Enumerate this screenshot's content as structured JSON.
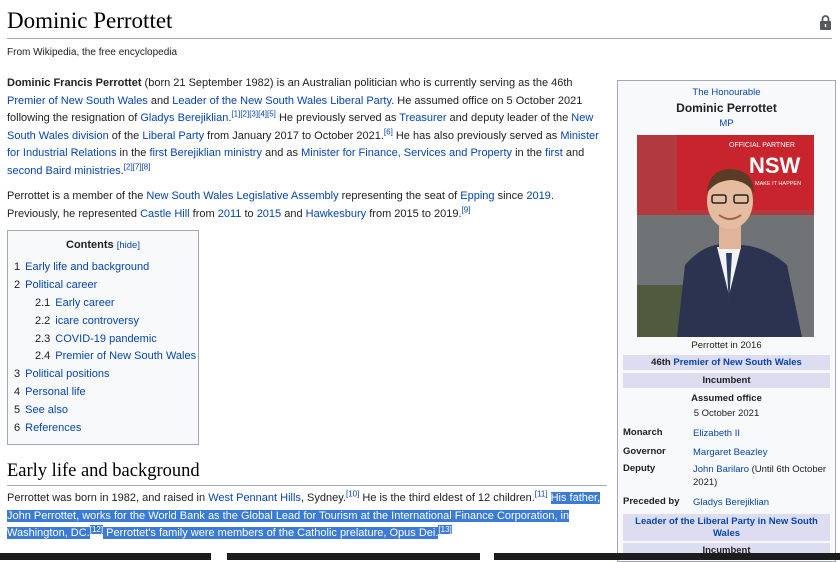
{
  "page": {
    "title": "Dominic Perrottet",
    "tagline": "From Wikipedia, the free encyclopedia",
    "lock_icon": "lock-icon"
  },
  "lead": {
    "p1": {
      "name_bold": "Dominic Francis Perrottet",
      "t1": " (born 21 September 1982) is an Australian politician who is currently serving as the 46th ",
      "l1": "Premier of New South Wales",
      "t2": " and ",
      "l2": "Leader of the New South Wales Liberal Party",
      "t3": ". He assumed office on 5 October 2021 following the resignation of ",
      "l3": "Gladys Berejiklian",
      "t4": ".",
      "s1": "[1][2][3][4][5]",
      "t5": " He previously served as ",
      "l4": "Treasurer",
      "t6": " and deputy leader of the ",
      "l5": "New South Wales division",
      "t7": " of the ",
      "l6": "Liberal Party",
      "t8": " from January 2017 to October 2021.",
      "s2": "[6]",
      "t9": " He has also previously served as ",
      "l7": "Minister for Industrial Relations",
      "t10": " in the ",
      "l8": "first Berejiklian ministry",
      "t11": " and as ",
      "l9": "Minister for Finance, Services and Property",
      "t12": " in the ",
      "l10": "first",
      "t13": " and ",
      "l11": "second Baird ministries",
      "t14": ".",
      "s3": "[2][7][8]"
    },
    "p2": {
      "t1": "Perrottet is a member of the ",
      "l1": "New South Wales Legislative Assembly",
      "t2": " representing the seat of ",
      "l2": "Epping",
      "t3": " since ",
      "l3": "2019",
      "t4": ". Previously, he represented ",
      "l4": "Castle Hill",
      "t5": " from ",
      "l5": "2011",
      "t6": " to ",
      "l6": "2015",
      "t7": " and ",
      "l7": "Hawkesbury",
      "t8": " from 2015 to 2019.",
      "s1": "[9]"
    }
  },
  "toc": {
    "title": "Contents",
    "hide": "[hide]",
    "items": [
      {
        "num": "1",
        "label": "Early life and background"
      },
      {
        "num": "2",
        "label": "Political career"
      },
      {
        "num": "2.1",
        "label": "Early career"
      },
      {
        "num": "2.2",
        "label": "icare controversy"
      },
      {
        "num": "2.3",
        "label": "COVID-19 pandemic"
      },
      {
        "num": "2.4",
        "label": "Premier of New South Wales"
      },
      {
        "num": "3",
        "label": "Political positions"
      },
      {
        "num": "4",
        "label": "Personal life"
      },
      {
        "num": "5",
        "label": "See also"
      },
      {
        "num": "6",
        "label": "References"
      }
    ]
  },
  "section1": {
    "heading": "Early life and background",
    "t1": "Perrottet was born in 1982, and raised in ",
    "l1": "West Pennant Hills",
    "t2": ", Sydney.",
    "s1": "[10]",
    "t3": " He is the third eldest of 12 children.",
    "s2": "[11]",
    "t4": " ",
    "sel1": "His father, John Perrottet, works for the World Bank as the Global Lead for Tourism at the International Finance Corporation, in Washington, DC.",
    "s3": "[12]",
    "sel2": " Perrottet's family were members of the Catholic prelature, Opus Dei.",
    "s4": "[13]"
  },
  "infobox": {
    "honorific": "The Honourable",
    "name": "Dominic Perrottet",
    "postnominal": "MP",
    "photo_sign_1": "OFFICIAL PARTNER",
    "photo_sign_2": "NSW",
    "photo_sign_3": "MAKE IT HAPPEN",
    "caption": "Perrottet in 2016",
    "office1_prefix": "46th ",
    "office1_link": "Premier of New South Wales",
    "incumbent": "Incumbent",
    "assumed_label": "Assumed office",
    "assumed_date": "5 October 2021",
    "rows": [
      {
        "key": "Monarch",
        "value": "Elizabeth II"
      },
      {
        "key": "Governor",
        "value": "Margaret Beazley"
      },
      {
        "key": "Deputy",
        "value": "John Barilaro",
        "extra": " (Until 6th October 2021)"
      },
      {
        "key": "Preceded by",
        "value": "Gladys Berejiklian"
      }
    ],
    "office2": "Leader of the Liberal Party in New South Wales",
    "incumbent2": "Incumbent"
  },
  "colors": {
    "link": "#0645ad",
    "selection": "#3b7bd6",
    "infobox_band": "#ddddf2"
  }
}
